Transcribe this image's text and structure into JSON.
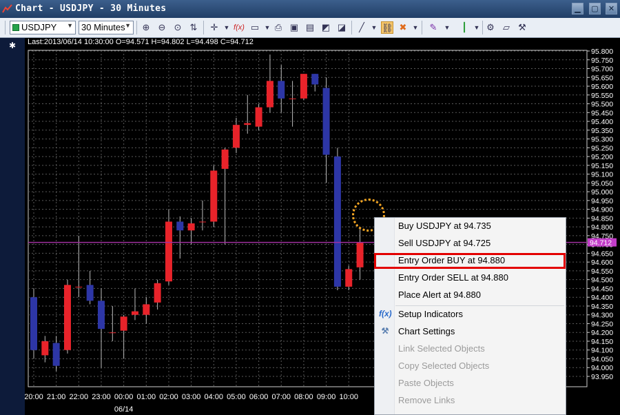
{
  "window": {
    "title": "Chart - USDJPY - 30 Minutes",
    "buttons": [
      "minimize",
      "maximize",
      "close"
    ]
  },
  "toolbar": {
    "symbol": "USDJPY",
    "timeframe": "30 Minutes",
    "icons": [
      "zoom-in-icon",
      "zoom-out-icon",
      "zoom-fit-icon",
      "sort-icon",
      "crosshair-icon",
      "fx-indicator-icon",
      "chart-window-icon",
      "print-icon",
      "save-icon",
      "document-icon",
      "chart-save-icon",
      "chart-export-icon",
      "line-tool-icon",
      "link-icon",
      "remove-link-icon",
      "drawing-tools-icon",
      "candlestick-icon",
      "settings-icon",
      "note-icon",
      "tools-icon"
    ]
  },
  "chart": {
    "info_line": "Last:2013/06/14 10:30:00 O=94.571 H=94.802 L=94.498 C=94.712",
    "current_price_label": "94.712",
    "date_label": "06/14"
  },
  "chart_data": {
    "type": "candlestick",
    "symbol": "USDJPY",
    "ylim": [
      93.95,
      95.8
    ],
    "y_ticks": [
      "95.800",
      "95.750",
      "95.700",
      "95.650",
      "95.600",
      "95.550",
      "95.500",
      "95.450",
      "95.400",
      "95.350",
      "95.300",
      "95.250",
      "95.200",
      "95.150",
      "95.100",
      "95.050",
      "95.000",
      "94.950",
      "94.900",
      "94.850",
      "94.800",
      "94.750",
      "94.700",
      "94.650",
      "94.600",
      "94.550",
      "94.500",
      "94.450",
      "94.400",
      "94.350",
      "94.300",
      "94.250",
      "94.200",
      "94.150",
      "94.100",
      "94.050",
      "94.000",
      "93.950"
    ],
    "x_ticks": [
      "20:00",
      "21:00",
      "22:00",
      "23:00",
      "00:00",
      "01:00",
      "02:00",
      "03:00",
      "04:00",
      "05:00",
      "06:00",
      "07:00",
      "08:00",
      "09:00",
      "10:00"
    ],
    "current_price": 94.712,
    "up_color": "#e8232a",
    "down_color": "#2d36a6",
    "candles": [
      {
        "o": 94.4,
        "h": 94.45,
        "l": 94.05,
        "c": 94.1
      },
      {
        "o": 94.07,
        "h": 94.18,
        "l": 94.03,
        "c": 94.15
      },
      {
        "o": 94.14,
        "h": 94.18,
        "l": 93.98,
        "c": 94.01
      },
      {
        "o": 94.1,
        "h": 94.5,
        "l": 94.08,
        "c": 94.47
      },
      {
        "o": 94.46,
        "h": 94.75,
        "l": 94.4,
        "c": 94.46
      },
      {
        "o": 94.47,
        "h": 94.55,
        "l": 94.36,
        "c": 94.38
      },
      {
        "o": 94.38,
        "h": 94.45,
        "l": 94.0,
        "c": 94.22
      },
      {
        "o": 94.2,
        "h": 94.35,
        "l": 94.15,
        "c": 94.2
      },
      {
        "o": 94.21,
        "h": 94.3,
        "l": 94.05,
        "c": 94.29
      },
      {
        "o": 94.3,
        "h": 94.45,
        "l": 94.27,
        "c": 94.32
      },
      {
        "o": 94.3,
        "h": 94.4,
        "l": 94.25,
        "c": 94.36
      },
      {
        "o": 94.37,
        "h": 94.5,
        "l": 94.33,
        "c": 94.48
      },
      {
        "o": 94.49,
        "h": 94.9,
        "l": 94.47,
        "c": 94.83
      },
      {
        "o": 94.83,
        "h": 94.86,
        "l": 94.62,
        "c": 94.78
      },
      {
        "o": 94.78,
        "h": 94.85,
        "l": 94.7,
        "c": 94.82
      },
      {
        "o": 94.83,
        "h": 94.95,
        "l": 94.78,
        "c": 94.83
      },
      {
        "o": 94.83,
        "h": 95.15,
        "l": 94.8,
        "c": 95.12
      },
      {
        "o": 95.13,
        "h": 95.25,
        "l": 94.7,
        "c": 95.24
      },
      {
        "o": 95.25,
        "h": 95.42,
        "l": 95.22,
        "c": 95.38
      },
      {
        "o": 95.38,
        "h": 95.55,
        "l": 95.33,
        "c": 95.39
      },
      {
        "o": 95.37,
        "h": 95.5,
        "l": 95.35,
        "c": 95.48
      },
      {
        "o": 95.48,
        "h": 95.78,
        "l": 95.45,
        "c": 95.63
      },
      {
        "o": 95.63,
        "h": 95.72,
        "l": 95.45,
        "c": 95.53
      },
      {
        "o": 95.53,
        "h": 95.63,
        "l": 95.37,
        "c": 95.53
      },
      {
        "o": 95.53,
        "h": 95.67,
        "l": 95.52,
        "c": 95.67
      },
      {
        "o": 95.67,
        "h": 95.67,
        "l": 95.57,
        "c": 95.61
      },
      {
        "o": 95.59,
        "h": 95.65,
        "l": 95.05,
        "c": 95.21
      },
      {
        "o": 95.2,
        "h": 95.25,
        "l": 94.44,
        "c": 94.46
      },
      {
        "o": 94.46,
        "h": 94.58,
        "l": 94.44,
        "c": 94.56
      },
      {
        "o": 94.57,
        "h": 94.8,
        "l": 94.5,
        "c": 94.71
      }
    ]
  },
  "context_menu": {
    "items": [
      {
        "label": "Buy USDJPY at 94.735",
        "enabled": true,
        "icon": ""
      },
      {
        "label": "Sell USDJPY at 94.725",
        "enabled": true,
        "icon": ""
      },
      {
        "label": "Entry Order BUY at 94.880",
        "enabled": true,
        "icon": "",
        "highlighted": true
      },
      {
        "label": "Entry Order SELL at 94.880",
        "enabled": true,
        "icon": ""
      },
      {
        "label": "Place Alert at 94.880",
        "enabled": true,
        "icon": ""
      },
      {
        "label": "Setup Indicators",
        "enabled": true,
        "icon": "fx-indicator-icon"
      },
      {
        "label": "Chart Settings",
        "enabled": true,
        "icon": "tools-icon"
      },
      {
        "label": "Link Selected Objects",
        "enabled": false,
        "icon": ""
      },
      {
        "label": "Copy Selected Objects",
        "enabled": false,
        "icon": ""
      },
      {
        "label": "Paste Objects",
        "enabled": false,
        "icon": ""
      },
      {
        "label": "Remove Links",
        "enabled": false,
        "icon": ""
      }
    ]
  }
}
